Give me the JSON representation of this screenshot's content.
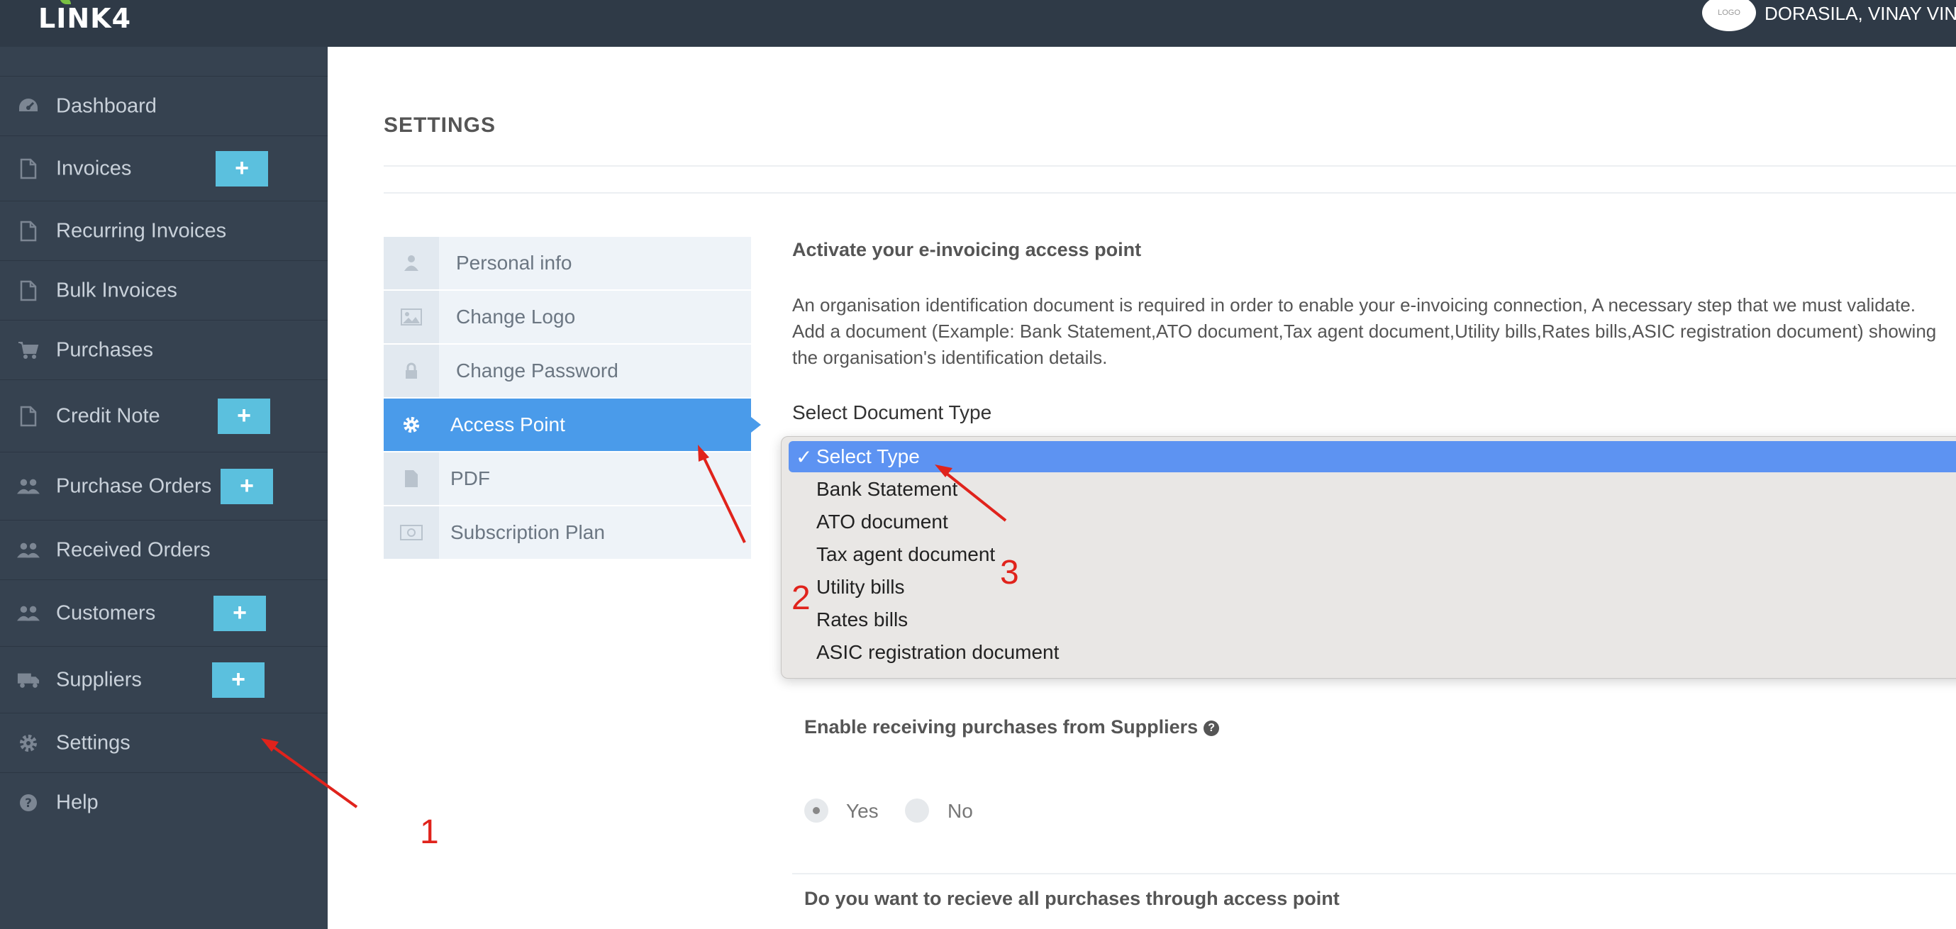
{
  "header": {
    "logo_text": "LINK4",
    "avatar_text": "LOGO",
    "user_name": "DORASILA, VINAY VINNU"
  },
  "sidebar": {
    "items": [
      {
        "label": "Dashboard",
        "icon": "dashboard-icon"
      },
      {
        "label": "Invoices",
        "icon": "file-icon",
        "plus": "+"
      },
      {
        "label": "Recurring Invoices",
        "icon": "file-icon"
      },
      {
        "label": "Bulk Invoices",
        "icon": "file-icon"
      },
      {
        "label": "Purchases",
        "icon": "cart-icon"
      },
      {
        "label": "Credit Note",
        "icon": "file-icon",
        "plus": "+"
      },
      {
        "label": "Purchase Orders",
        "icon": "users-icon",
        "plus": "+"
      },
      {
        "label": "Received Orders",
        "icon": "users-icon"
      },
      {
        "label": "Customers",
        "icon": "users-icon",
        "plus": "+"
      },
      {
        "label": "Suppliers",
        "icon": "truck-icon",
        "plus": "+"
      },
      {
        "label": "Settings",
        "icon": "gear-icon"
      },
      {
        "label": "Help",
        "icon": "question-icon"
      }
    ]
  },
  "main": {
    "title": "SETTINGS",
    "settings_nav": [
      {
        "label": "Personal info",
        "icon": "user-icon"
      },
      {
        "label": "Change Logo",
        "icon": "image-icon"
      },
      {
        "label": "Change Password",
        "icon": "lock-icon"
      },
      {
        "label": "Access Point",
        "icon": "gear-icon",
        "active": true
      },
      {
        "label": "PDF",
        "icon": "file-icon"
      },
      {
        "label": "Subscription Plan",
        "icon": "money-icon"
      }
    ],
    "access_point": {
      "heading": "Activate your e-invoicing access point",
      "description": "An organisation identification document is required in order to enable your e-invoicing connection, A necessary step that we must validate. Add a document (Example: Bank Statement,ATO document,Tax agent document,Utility bills,Rates bills,ASIC registration document) showing the organisation's identification details.",
      "doc_type_label": "Select Document Type",
      "doc_type_options": [
        "Select Type",
        "Bank Statement",
        "ATO document",
        "Tax agent document",
        "Utility bills",
        "Rates bills",
        "ASIC registration document"
      ],
      "doc_type_selected": "Select Type",
      "check_mark": "✓",
      "receiving_label": "Enable receiving purchases from Suppliers",
      "receiving_help": "?",
      "radio_yes": "Yes",
      "radio_no": "No",
      "radio_selected": "Yes",
      "all_purchases_label": "Do you want to recieve all purchases through access point"
    }
  },
  "annotations": {
    "labels": [
      "1",
      "2",
      "3"
    ],
    "color": "#e0231c"
  },
  "colors": {
    "topbar": "#2f3a47",
    "sidebar": "#364250",
    "accent_plus": "#5bc0de",
    "active_nav": "#4a9bea",
    "dropdown_selected": "#5d93f2"
  }
}
